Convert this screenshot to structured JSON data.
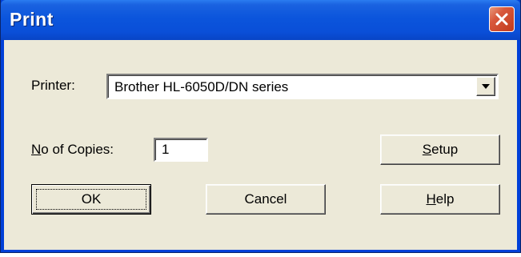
{
  "window": {
    "title": "Print"
  },
  "printer": {
    "label": "Printer:",
    "selected": "Brother HL-6050D/DN series"
  },
  "copies": {
    "label_mnemonic": "N",
    "label_rest": "o of Copies:",
    "value": "1"
  },
  "buttons": {
    "setup_mnemonic": "S",
    "setup_rest": "etup",
    "ok": "OK",
    "cancel": "Cancel",
    "help_mnemonic": "H",
    "help_rest": "elp"
  },
  "icons": {
    "close": "close-icon",
    "dropdown": "dropdown-arrow-icon"
  },
  "colors": {
    "titlebar": "#0a4fd8",
    "client": "#ece9d8",
    "close": "#d8583c"
  }
}
